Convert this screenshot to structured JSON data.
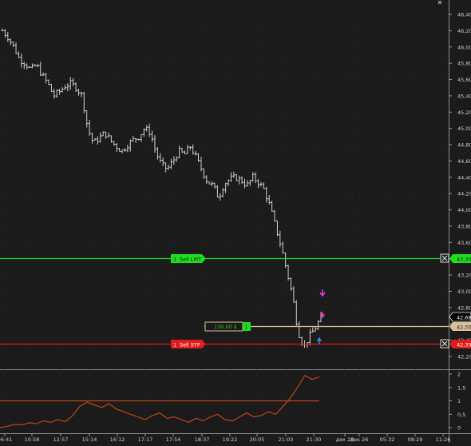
{
  "price_axis": {
    "ticks": [
      "46,40",
      "46,20",
      "46,00",
      "45,80",
      "45,60",
      "45,40",
      "45,20",
      "45,00",
      "44,80",
      "44,60",
      "44,40",
      "44,20",
      "44,00",
      "43,80",
      "43,60",
      "43,40",
      "43,20",
      "43,00",
      "42,80",
      "42,60",
      "42,40",
      "42,20"
    ]
  },
  "time_axis": {
    "ticks": [
      "06:41",
      "10:58",
      "12:57",
      "15:14",
      "16:12",
      "17:17",
      "17:54",
      "18:37",
      "19:22",
      "20:05",
      "21:03",
      "21:30",
      "дек 28",
      "дек 26",
      "05:32",
      "08:29",
      "11:26"
    ]
  },
  "oscillator_axis": {
    "ticks": [
      "2",
      "1,5",
      "1",
      "0,5",
      "0"
    ]
  },
  "orders": {
    "sell_lmt": {
      "qty": "1",
      "label": "Sell LMT",
      "price_tag": "43,30",
      "color": "#1fdc1f"
    },
    "sell_stp": {
      "qty": "1",
      "label": "Sell STP",
      "price_tag": "42,35",
      "color": "#e01b1b"
    },
    "position": {
      "pnl": "130,00 $",
      "qty": "1",
      "price_tag": "42,55",
      "color": "#d8bf9a"
    }
  },
  "price_tags": {
    "last_price": "42,68"
  },
  "colors": {
    "background": "#1b1b1b",
    "grid": "#2c2c2c",
    "bars": "#cfcfcf",
    "oscillator": "#c0441c",
    "buy_marker": "#2a90ff",
    "sell_marker": "#e83ae0"
  },
  "chart_data": {
    "type": "ohlc",
    "ylim": [
      42.1,
      46.5
    ],
    "x": [
      "06:41",
      "10:58",
      "12:57",
      "15:14",
      "16:12",
      "17:17",
      "17:54",
      "18:37",
      "19:22",
      "20:05",
      "21:03",
      "21:30"
    ],
    "path_close": [
      46.2,
      46.12,
      46.0,
      45.85,
      45.8,
      45.72,
      45.78,
      45.65,
      45.55,
      45.4,
      45.45,
      45.52,
      45.55,
      45.5,
      45.4,
      45.0,
      44.82,
      44.88,
      44.95,
      44.85,
      44.78,
      44.72,
      44.8,
      44.86,
      44.9,
      45.0,
      44.95,
      44.7,
      44.55,
      44.5,
      44.6,
      44.72,
      44.68,
      44.78,
      44.65,
      44.5,
      44.35,
      44.3,
      44.15,
      44.32,
      44.38,
      44.4,
      44.36,
      44.3,
      44.4,
      44.34,
      44.25,
      44.05,
      43.8,
      43.55,
      43.25,
      42.95,
      42.5,
      42.32,
      42.45,
      42.55,
      42.68
    ],
    "oscillator": {
      "ylim": [
        0,
        2
      ],
      "level": 1,
      "values": [
        0.0,
        0.05,
        0.12,
        0.1,
        0.18,
        0.15,
        0.25,
        0.2,
        0.3,
        0.22,
        0.45,
        0.8,
        0.95,
        0.85,
        0.75,
        0.9,
        0.7,
        0.6,
        0.5,
        0.4,
        0.3,
        0.45,
        0.55,
        0.35,
        0.4,
        0.3,
        0.2,
        0.35,
        0.25,
        0.4,
        0.5,
        0.3,
        0.25,
        0.4,
        0.55,
        0.4,
        0.45,
        0.6,
        0.5,
        0.8,
        1.1,
        1.5,
        1.95,
        1.8,
        1.9
      ]
    }
  }
}
